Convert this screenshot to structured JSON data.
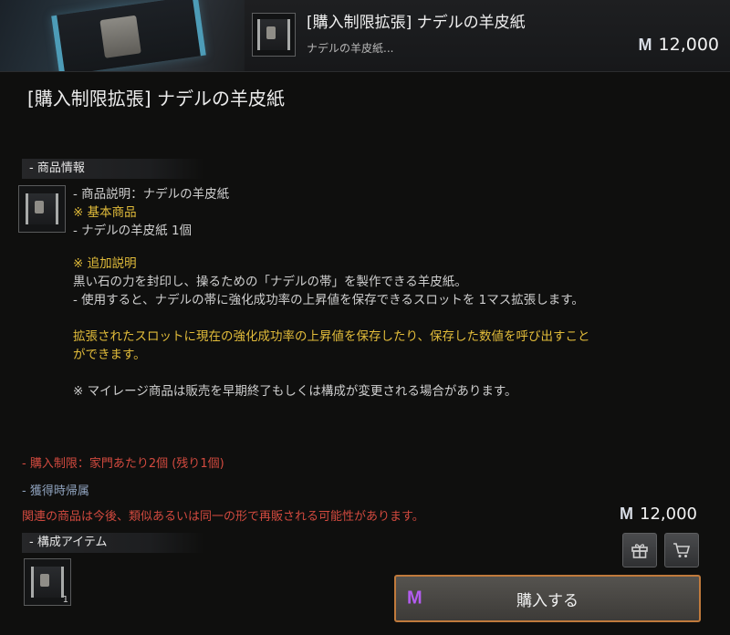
{
  "header": {
    "title": "[購入制限拡張] ナデルの羊皮紙",
    "subtitle": "ナデルの羊皮紙...",
    "price": "12,000",
    "currency_icon": "mileage-icon"
  },
  "main_title": "[購入制限拡張] ナデルの羊皮紙",
  "product_info": {
    "label": "- 商品情報",
    "desc_line1": "- 商品説明：ナデルの羊皮紙",
    "basic_header": "※ 基本商品",
    "basic_item": "- ナデルの羊皮紙 1個",
    "extra_header": "※ 追加説明",
    "extra_line1": "黒い石の力を封印し、操るための「ナデルの帯」を製作できる羊皮紙。",
    "extra_line2": "- 使用すると、ナデルの帯に強化成功率の上昇値を保存できるスロットを 1マス拡張します。",
    "gold_line1": "拡張されたスロットに現在の強化成功率の上昇値を保存したり、保存した数値を呼び出すこと",
    "gold_line2": "ができます。",
    "mileage_note": "※ マイレージ商品は販売を早期終了もしくは構成が変更される場合があります。"
  },
  "purchase_limit": {
    "prefix": "- 購入制限：家門あたり2個 (残り",
    "remaining": "1",
    "suffix": "個)"
  },
  "acquire_bind": "- 獲得時帰属",
  "resale_note": "関連の商品は今後、類似あるいは同一の形で再販される可能性があります。",
  "bottom_price": "12,000",
  "components": {
    "label": "- 構成アイテム",
    "item_count": "1"
  },
  "buy_button": "購入する",
  "colors": {
    "gold_text": "#e2bc3a",
    "red_text": "#d24a3f",
    "accent_border": "#c07a3c",
    "mileage_purple": "#b35cf0"
  }
}
